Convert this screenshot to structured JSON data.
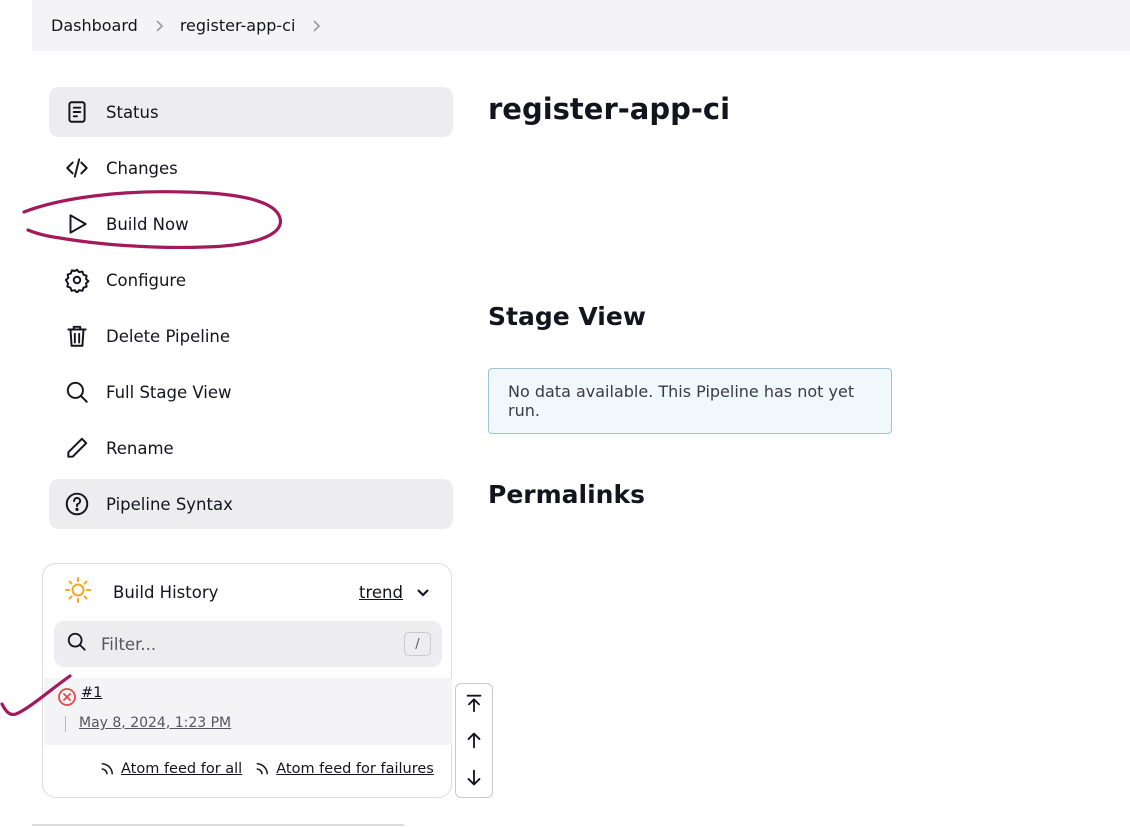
{
  "breadcrumb": {
    "items": [
      "Dashboard",
      "register-app-ci"
    ],
    "separator_icon": "chevron-right-icon"
  },
  "sidebar": {
    "items": [
      {
        "label": "Status",
        "icon": "document-icon"
      },
      {
        "label": "Changes",
        "icon": "code-icon"
      },
      {
        "label": "Build Now",
        "icon": "play-icon"
      },
      {
        "label": "Configure",
        "icon": "gear-icon"
      },
      {
        "label": "Delete Pipeline",
        "icon": "trash-icon"
      },
      {
        "label": "Full Stage View",
        "icon": "search-icon"
      },
      {
        "label": "Rename",
        "icon": "pencil-icon"
      },
      {
        "label": "Pipeline Syntax",
        "icon": "help-circle-icon"
      }
    ]
  },
  "build_history": {
    "title": "Build History",
    "trend_label": "trend",
    "filter": {
      "placeholder": "Filter...",
      "shortcut": "/"
    },
    "builds": [
      {
        "number": "#1",
        "date": "May 8, 2024, 1:23 PM",
        "status": "failed",
        "status_color": "#e5484d"
      }
    ],
    "feeds": [
      {
        "label": "Atom feed for all"
      },
      {
        "label": "Atom feed for failures"
      }
    ]
  },
  "main": {
    "title": "register-app-ci",
    "stage_view": {
      "heading": "Stage View",
      "message": "No data available. This Pipeline has not yet run."
    },
    "permalinks_heading": "Permalinks"
  },
  "colors": {
    "annotation": "#a3195b",
    "sun": "#f5a623",
    "alert_border": "#9fc3d8",
    "alert_bg": "#f1f8fc"
  }
}
